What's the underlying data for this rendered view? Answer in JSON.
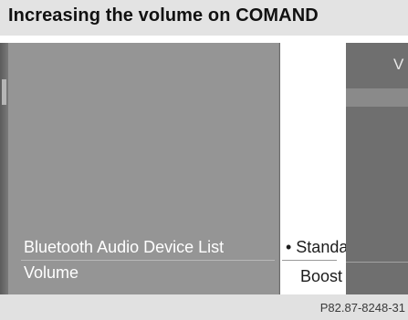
{
  "header": {
    "title": "Increasing the volume on COMAND"
  },
  "menu": {
    "items": [
      {
        "label": "Bluetooth Audio Device List"
      },
      {
        "label": "Volume"
      }
    ]
  },
  "submenu": {
    "items": [
      {
        "label": "• Standard",
        "selected": true
      },
      {
        "label": "Boost",
        "selected": false
      }
    ]
  },
  "right_edge": {
    "partial_letter": "V"
  },
  "footer": {
    "code": "P82.87-8248-31"
  },
  "colors": {
    "title_bar": "#e3e3e3",
    "screen_background": "#959595",
    "submenu_background": "#ffffff",
    "footer_bar": "#e1e1e1"
  }
}
